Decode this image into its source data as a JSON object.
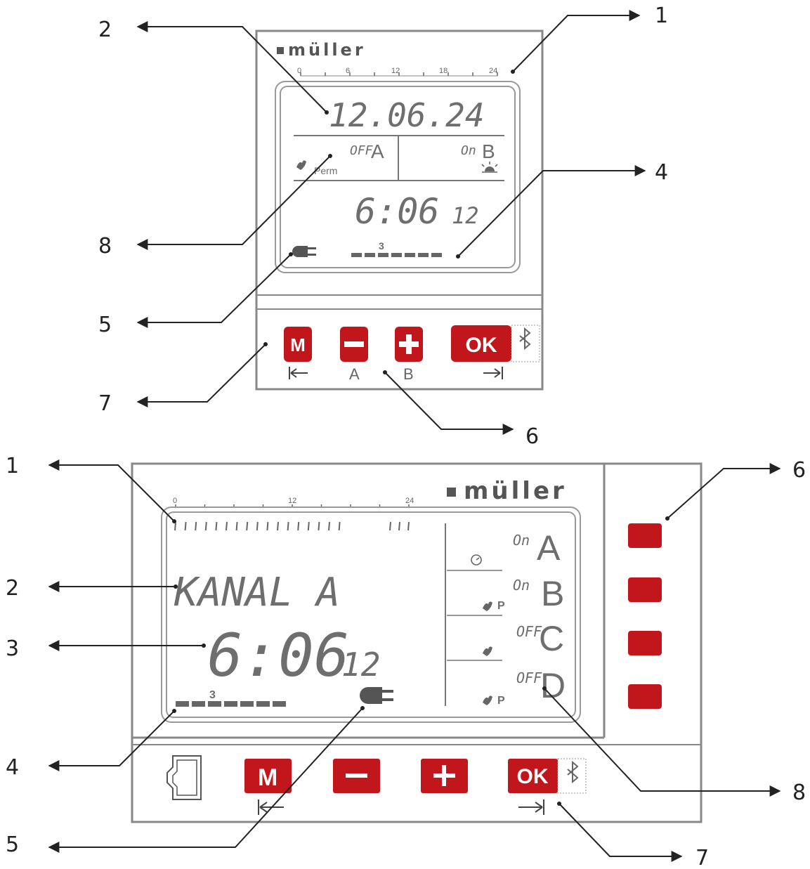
{
  "device1": {
    "brand": "müller",
    "scale": [
      "0",
      "6",
      "12",
      "18",
      "24"
    ],
    "date": "12.06.24",
    "channel_a_state": "OFF",
    "channel_a_letter": "A",
    "channel_b_state": "On",
    "channel_b_letter": "B",
    "perm_label": "Perm",
    "time": "6:06",
    "seconds": "12",
    "weekday": "3",
    "buttons": {
      "m": "M",
      "minus": "−",
      "plus": "+",
      "ok": "OK"
    },
    "sub_labels": {
      "minus": "A",
      "plus": "B"
    },
    "callouts": [
      "1",
      "2",
      "4",
      "8",
      "5",
      "7",
      "6"
    ]
  },
  "device2": {
    "brand": "müller",
    "scale": [
      "0",
      "12",
      "24"
    ],
    "channel_text": "KANAL A",
    "time": "6:06",
    "seconds": "12",
    "weekday": "3",
    "channels": [
      {
        "state": "On",
        "letter": "A",
        "extra": ""
      },
      {
        "state": "On",
        "letter": "B",
        "extra": "P"
      },
      {
        "state": "OFF",
        "letter": "C",
        "extra": ""
      },
      {
        "state": "OFF",
        "letter": "D",
        "extra": "P"
      }
    ],
    "buttons": {
      "m": "M",
      "minus": "−",
      "plus": "+",
      "ok": "OK"
    },
    "callouts": [
      "1",
      "2",
      "3",
      "4",
      "5",
      "6",
      "8",
      "7"
    ]
  },
  "colors": {
    "button_red": "#c0161c",
    "lcd_gray": "#6e6e6e",
    "frame_gray": "#888888"
  },
  "icons": [
    "plug-icon",
    "sun-icon",
    "hand-icon",
    "bluetooth-icon",
    "card-slot-icon",
    "clock-icon"
  ]
}
